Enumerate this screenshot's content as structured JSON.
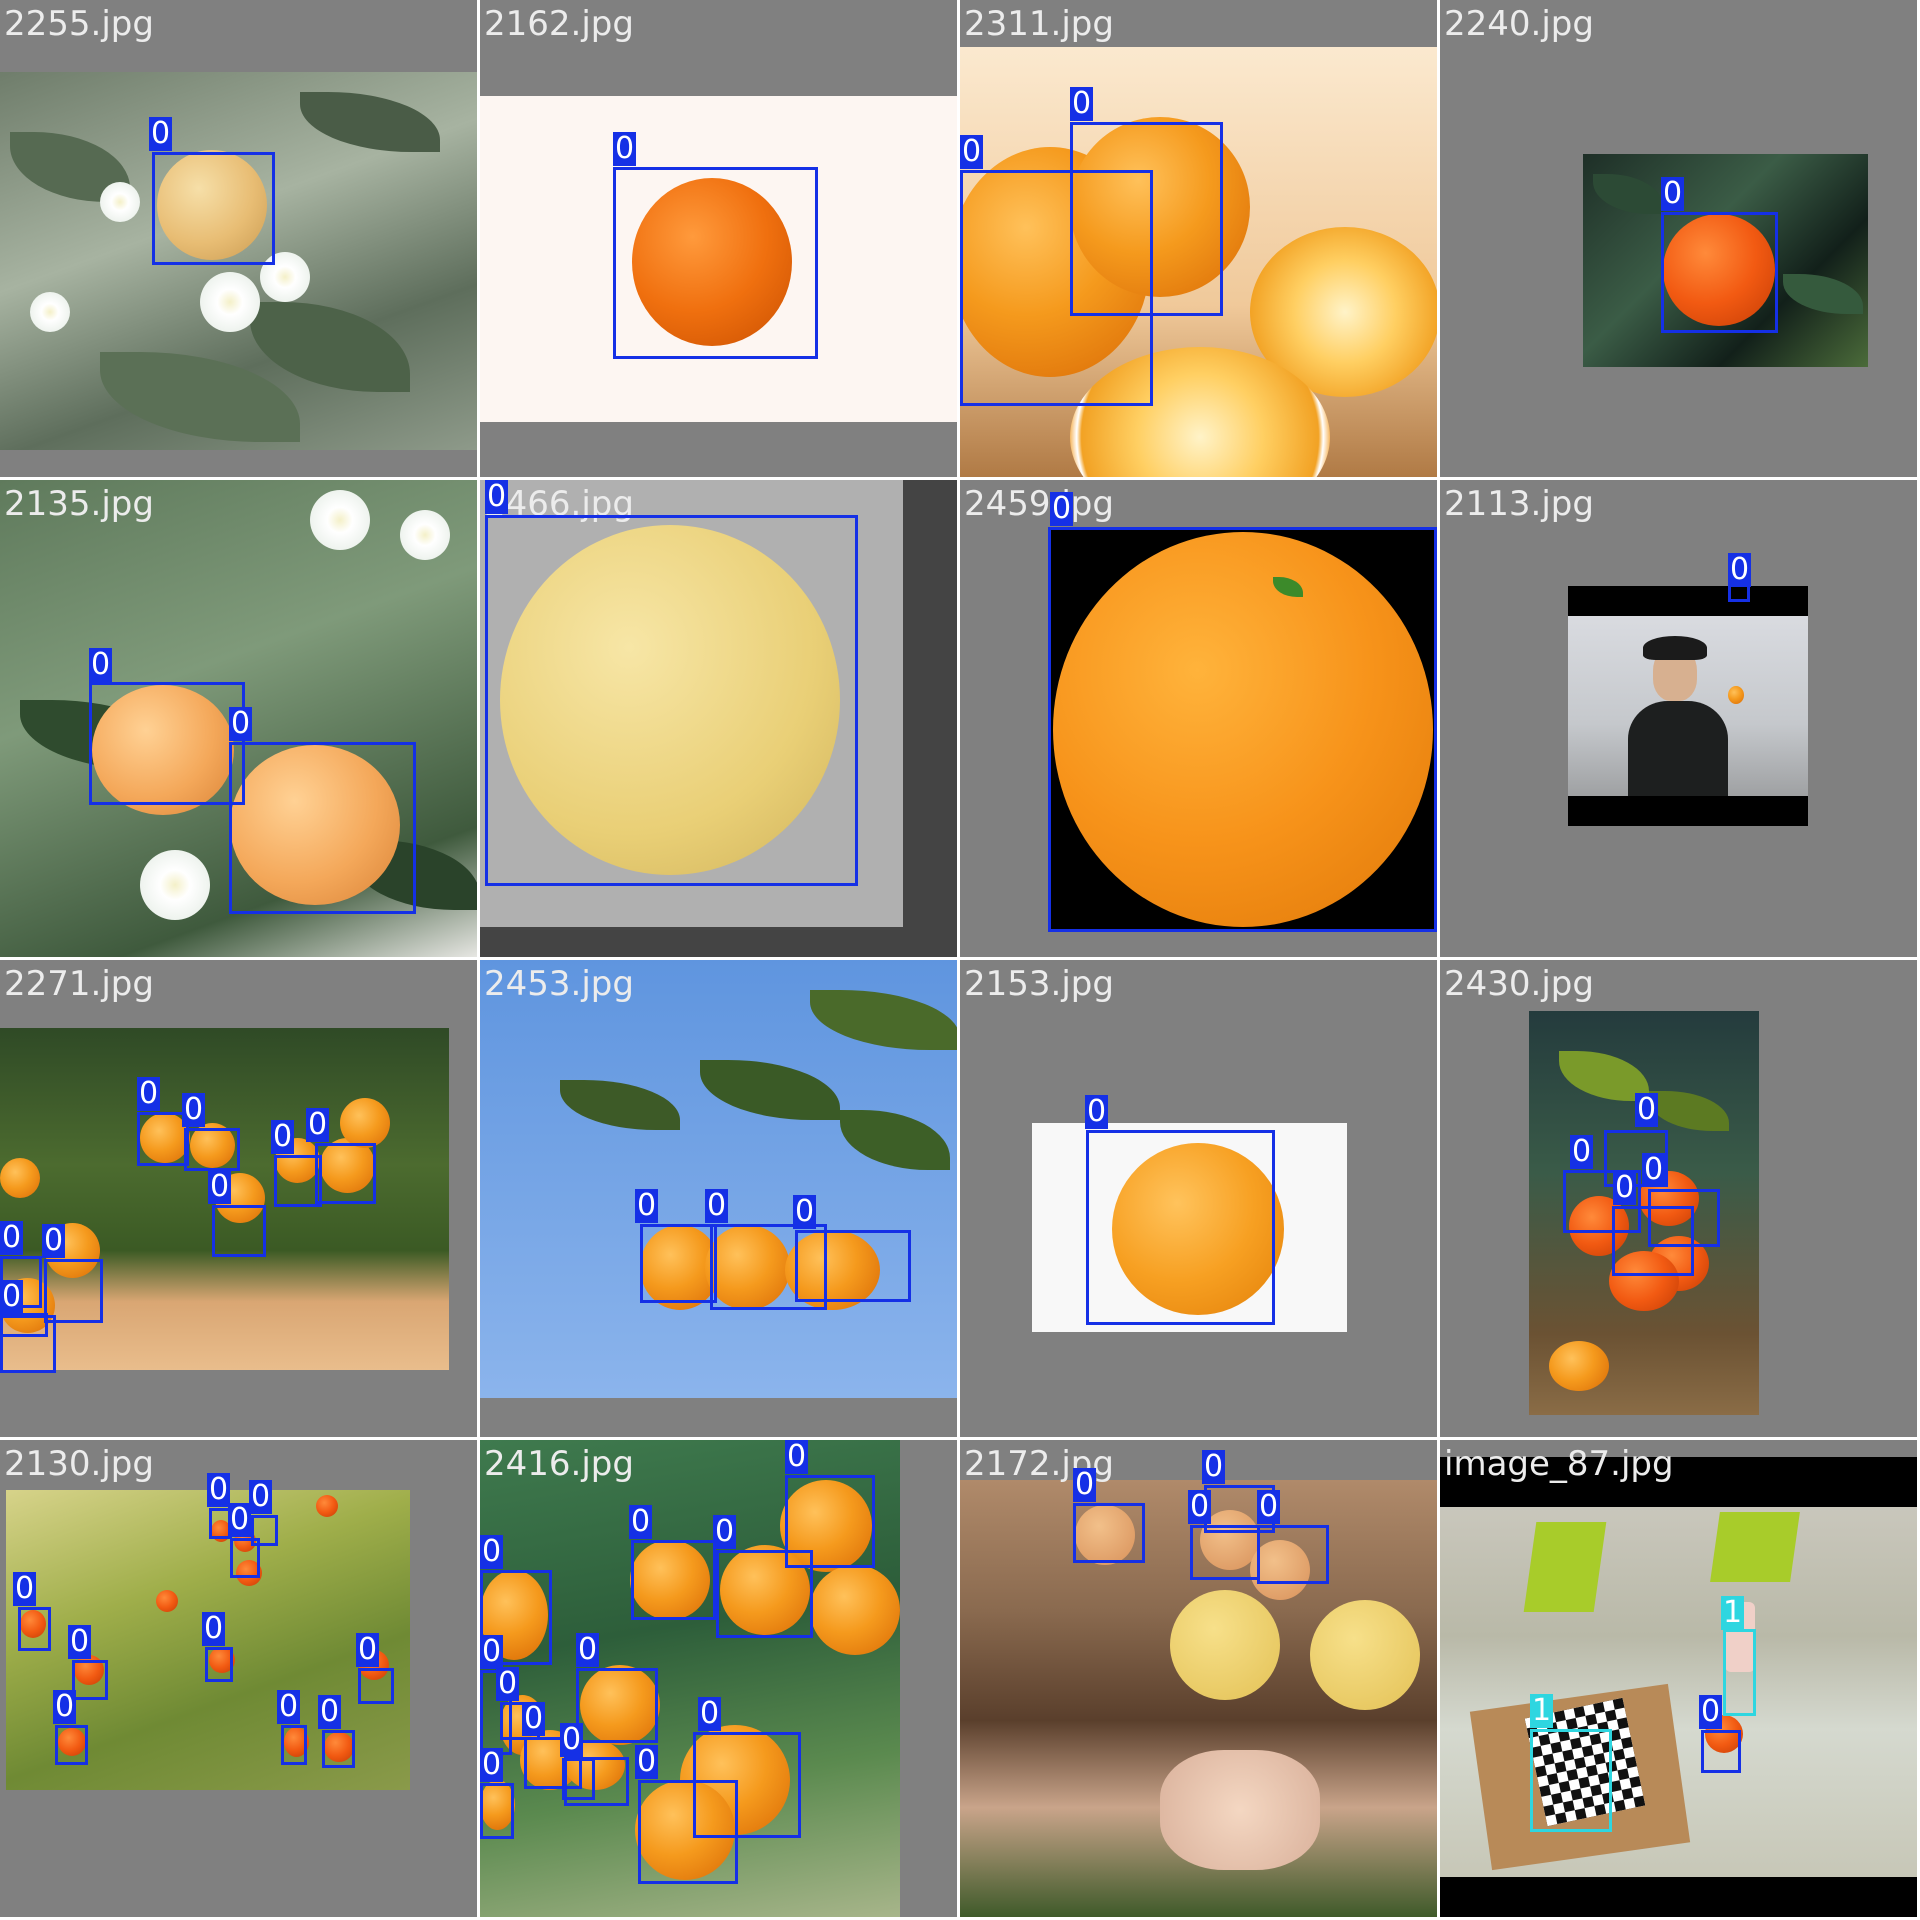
{
  "tiles": [
    {
      "filename": "2255.jpg",
      "labels": [
        "0"
      ]
    },
    {
      "filename": "2162.jpg",
      "labels": [
        "0"
      ]
    },
    {
      "filename": "2311.jpg",
      "labels": [
        "0",
        "0"
      ]
    },
    {
      "filename": "2240.jpg",
      "labels": [
        "0"
      ]
    },
    {
      "filename": "2135.jpg",
      "labels": [
        "0",
        "0"
      ]
    },
    {
      "filename": "2466.jpg",
      "labels": [
        "0"
      ]
    },
    {
      "filename": "2459.jpg",
      "labels": [
        "0"
      ]
    },
    {
      "filename": "2113.jpg",
      "labels": [
        "0"
      ]
    },
    {
      "filename": "2271.jpg",
      "labels": [
        "0",
        "0",
        "0",
        "0",
        "0",
        "0",
        "0",
        "0",
        "0"
      ]
    },
    {
      "filename": "2453.jpg",
      "labels": [
        "0",
        "0",
        "0"
      ]
    },
    {
      "filename": "2153.jpg",
      "labels": [
        "0"
      ]
    },
    {
      "filename": "2430.jpg",
      "labels": [
        "0",
        "0",
        "0",
        "0"
      ]
    },
    {
      "filename": "2130.jpg",
      "labels": [
        "0",
        "0",
        "0",
        "0",
        "0",
        "0",
        "0",
        "0",
        "0",
        "0",
        "0"
      ]
    },
    {
      "filename": "2416.jpg",
      "labels": [
        "0",
        "0",
        "0",
        "0",
        "0",
        "0",
        "0",
        "0",
        "0",
        "0",
        "0",
        "0",
        "0"
      ]
    },
    {
      "filename": "2172.jpg",
      "labels": [
        "0",
        "0",
        "0",
        "0"
      ]
    },
    {
      "filename": "image_87.jpg",
      "labels": [
        "1",
        "1",
        "0"
      ]
    }
  ],
  "colors": {
    "class_0_box": "#1530e6",
    "class_1_box": "#2ed6e0",
    "letterbox_gray": "#808080",
    "filename_text": "#ececec"
  }
}
